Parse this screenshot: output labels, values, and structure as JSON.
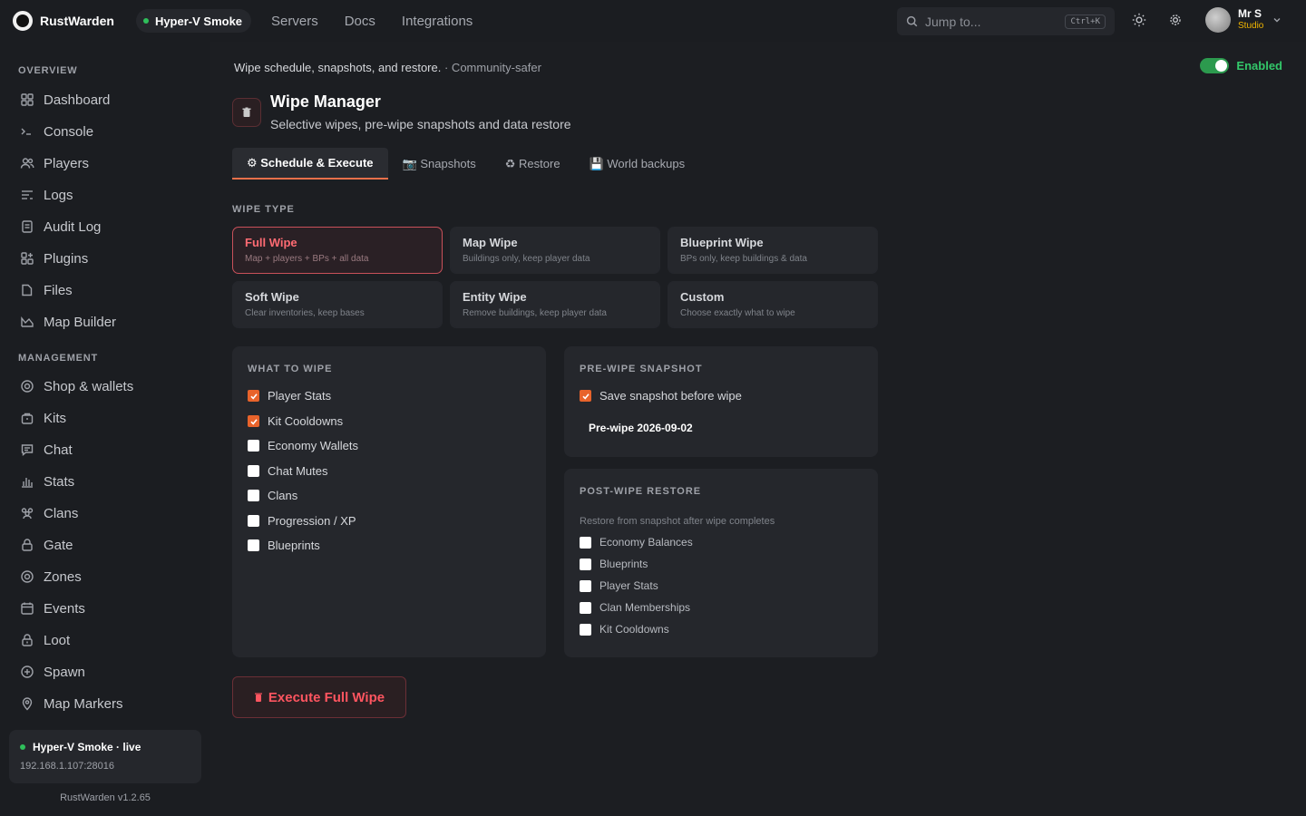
{
  "colors": {
    "accent": "#e8704a",
    "danger": "#ff5560",
    "success": "#33c86a",
    "studio": "#f2b600"
  },
  "brand": {
    "name": "RustWarden"
  },
  "server_pill": {
    "label": "Hyper-V Smoke"
  },
  "topnav": [
    {
      "label": "Servers"
    },
    {
      "label": "Docs"
    },
    {
      "label": "Integrations"
    }
  ],
  "search": {
    "placeholder": "Jump to...",
    "shortcut": "Ctrl+K"
  },
  "user": {
    "name": "Mr S",
    "role": "Studio"
  },
  "sidebar": {
    "overview_label": "OVERVIEW",
    "overview": [
      {
        "label": "Dashboard",
        "icon": "dashboard-icon"
      },
      {
        "label": "Console",
        "icon": "terminal-icon"
      },
      {
        "label": "Players",
        "icon": "users-icon"
      },
      {
        "label": "Logs",
        "icon": "logs-icon"
      },
      {
        "label": "Audit Log",
        "icon": "clipboard-icon"
      },
      {
        "label": "Plugins",
        "icon": "plugins-icon"
      },
      {
        "label": "Files",
        "icon": "file-icon"
      },
      {
        "label": "Map Builder",
        "icon": "map-icon"
      }
    ],
    "management_label": "MANAGEMENT",
    "management": [
      {
        "label": "Shop & wallets",
        "icon": "coin-icon"
      },
      {
        "label": "Kits",
        "icon": "bag-icon"
      },
      {
        "label": "Chat",
        "icon": "chat-icon"
      },
      {
        "label": "Stats",
        "icon": "bar-chart-icon"
      },
      {
        "label": "Clans",
        "icon": "group-icon"
      },
      {
        "label": "Gate",
        "icon": "lock-icon"
      },
      {
        "label": "Zones",
        "icon": "target-icon"
      },
      {
        "label": "Events",
        "icon": "calendar-icon"
      },
      {
        "label": "Loot",
        "icon": "loot-icon"
      },
      {
        "label": "Spawn",
        "icon": "plus-circle-icon"
      },
      {
        "label": "Map Markers",
        "icon": "pin-icon"
      }
    ],
    "live": {
      "title": "Hyper-V Smoke · live",
      "address": "192.168.1.107:28016"
    },
    "version": "RustWarden v1.2.65"
  },
  "header": {
    "breadcrumb": "Wipe schedule, snapshots, and restore.",
    "breadcrumb_sub": "· Community-safer",
    "enabled_label": "Enabled",
    "title": "Wipe Manager",
    "subtitle": "Selective wipes, pre-wipe snapshots and data restore",
    "page_icon": "trash-icon"
  },
  "tabs": [
    {
      "label": "⚙ Schedule & Execute",
      "active": true
    },
    {
      "label": "📷 Snapshots",
      "active": false
    },
    {
      "label": "♻ Restore",
      "active": false
    },
    {
      "label": "💾 World backups",
      "active": false
    }
  ],
  "wipe_type": {
    "label": "WIPE TYPE",
    "options": [
      {
        "title": "Full Wipe",
        "desc": "Map + players + BPs + all data",
        "selected": true
      },
      {
        "title": "Map Wipe",
        "desc": "Buildings only, keep player data",
        "selected": false
      },
      {
        "title": "Blueprint Wipe",
        "desc": "BPs only, keep buildings & data",
        "selected": false
      },
      {
        "title": "Soft Wipe",
        "desc": "Clear inventories, keep bases",
        "selected": false
      },
      {
        "title": "Entity Wipe",
        "desc": "Remove buildings, keep player data",
        "selected": false
      },
      {
        "title": "Custom",
        "desc": "Choose exactly what to wipe",
        "selected": false
      }
    ]
  },
  "what_to_wipe": {
    "title": "WHAT TO WIPE",
    "items": [
      {
        "label": "Player Stats",
        "checked": true
      },
      {
        "label": "Kit Cooldowns",
        "checked": true
      },
      {
        "label": "Economy Wallets",
        "checked": false
      },
      {
        "label": "Chat Mutes",
        "checked": false
      },
      {
        "label": "Clans",
        "checked": false
      },
      {
        "label": "Progression / XP",
        "checked": false
      },
      {
        "label": "Blueprints",
        "checked": false
      }
    ]
  },
  "pre_wipe": {
    "title": "PRE-WIPE SNAPSHOT",
    "save_label": "Save snapshot before wipe",
    "save_checked": true,
    "snapshot_name": "Pre-wipe 2026-09-02"
  },
  "post_wipe": {
    "title": "POST-WIPE RESTORE",
    "note": "Restore from snapshot after wipe completes",
    "items": [
      {
        "label": "Economy Balances",
        "checked": false
      },
      {
        "label": "Blueprints",
        "checked": false
      },
      {
        "label": "Player Stats",
        "checked": false
      },
      {
        "label": "Clan Memberships",
        "checked": false
      },
      {
        "label": "Kit Cooldowns",
        "checked": false
      }
    ]
  },
  "execute": {
    "label": "Execute Full Wipe"
  }
}
